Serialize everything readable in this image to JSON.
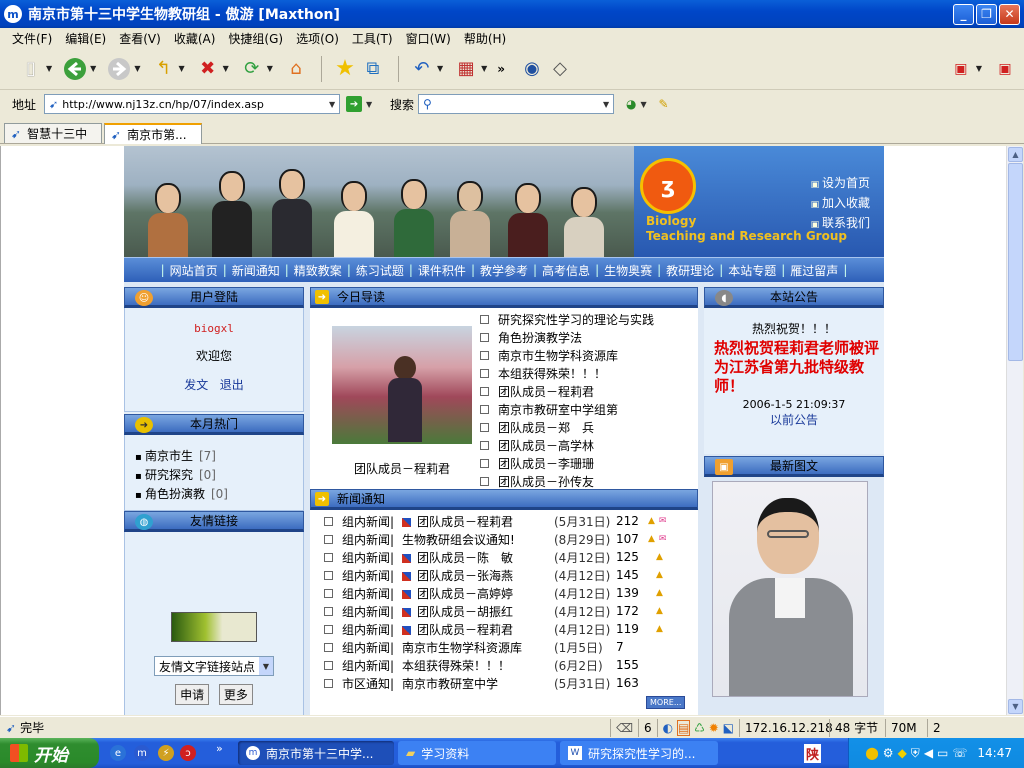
{
  "window": {
    "title": "南京市第十三中学生物教研组 - 傲游 [Maxthon]"
  },
  "menu": [
    "文件(F)",
    "编辑(E)",
    "查看(V)",
    "收藏(A)",
    "快捷组(G)",
    "选项(O)",
    "工具(T)",
    "窗口(W)",
    "帮助(H)"
  ],
  "toolbar": {
    "icons": [
      "new-page-icon",
      "back-icon",
      "forward-icon",
      "up-icon",
      "stop-icon",
      "refresh-icon",
      "home-icon",
      "favorites-star-icon",
      "switch-icon",
      "undo-icon",
      "calculator-icon",
      "compass-icon",
      "diamond-icon",
      "close-all-icon",
      "close-icon"
    ],
    "more": "»"
  },
  "address": {
    "label": "地址",
    "url": "http://www.nj13z.cn/hp/07/index.asp",
    "search_label": "搜索",
    "search_value": ""
  },
  "tabs": [
    "智慧十三中",
    "南京市第..."
  ],
  "site": {
    "logo_text1": "Biology",
    "logo_text2": "Teaching and Research Group",
    "quick_links": [
      "设为首页",
      "加入收藏",
      "联系我们"
    ],
    "nav": [
      "网站首页",
      "新闻通知",
      "精致教案",
      "练习试题",
      "课件积件",
      "教学参考",
      "高考信息",
      "生物奥赛",
      "教研理论",
      "本站专题",
      "雁过留声"
    ],
    "login": {
      "title": "用户登陆",
      "username": "biogxl",
      "welcome": "欢迎您",
      "post": "发文",
      "logout": "退出"
    },
    "hot": {
      "title": "本月热门",
      "items": [
        {
          "name": "南京市生",
          "count": "[7]"
        },
        {
          "name": "研究探究",
          "count": "[0]"
        },
        {
          "name": "角色扮演教",
          "count": "[0]"
        }
      ]
    },
    "links": {
      "title": "友情链接",
      "select": "友情文字链接站点",
      "apply": "申请",
      "more": "更多"
    },
    "guide": {
      "title": "今日导读",
      "caption": "团队成员－程莉君",
      "items": [
        "研究探究性学习的理论与实践",
        "角色扮演教学法",
        "南京市生物学科资源库",
        "本组获得殊荣！！！",
        "团队成员－程莉君",
        "南京市教研室中学组第",
        "团队成员－郑　兵",
        "团队成员－高学林",
        "团队成员－李珊珊",
        "团队成员－孙传友"
      ]
    },
    "news": {
      "title": "新闻通知",
      "more": "MORE...",
      "rows": [
        {
          "cat": "组内新闻|",
          "title": "团队成员－程莉君",
          "date": "(5月31日)",
          "count": "212",
          "icon": true,
          "up": true,
          "mail": true
        },
        {
          "cat": "组内新闻|",
          "title": "生物教研组会议通知!",
          "date": "(8月29日)",
          "count": "107",
          "icon": false,
          "up": true,
          "mail": true
        },
        {
          "cat": "组内新闻|",
          "title": "团队成员－陈　敏",
          "date": "(4月12日)",
          "count": "125",
          "icon": true,
          "up": true,
          "mail": false
        },
        {
          "cat": "组内新闻|",
          "title": "团队成员－张海燕",
          "date": "(4月12日)",
          "count": "145",
          "icon": true,
          "up": true,
          "mail": false
        },
        {
          "cat": "组内新闻|",
          "title": "团队成员－高婷婷",
          "date": "(4月12日)",
          "count": "139",
          "icon": true,
          "up": true,
          "mail": false
        },
        {
          "cat": "组内新闻|",
          "title": "团队成员－胡振红",
          "date": "(4月12日)",
          "count": "172",
          "icon": true,
          "up": true,
          "mail": false
        },
        {
          "cat": "组内新闻|",
          "title": "团队成员－程莉君",
          "date": "(4月12日)",
          "count": "119",
          "icon": true,
          "up": true,
          "mail": false
        },
        {
          "cat": "组内新闻|",
          "title": "南京市生物学科资源库",
          "date": "(1月5日)",
          "count": "7",
          "icon": false,
          "up": false,
          "mail": false
        },
        {
          "cat": "组内新闻|",
          "title": "本组获得殊荣！！！",
          "date": "(6月2日)",
          "count": "155",
          "icon": false,
          "up": false,
          "mail": false
        },
        {
          "cat": "市区通知|",
          "title": "南京市教研室中学",
          "date": "(5月31日)",
          "count": "163",
          "icon": false,
          "up": false,
          "mail": false
        }
      ]
    },
    "notice": {
      "title": "本站公告",
      "heading": "热烈祝贺！！！",
      "body": "热烈祝贺程莉君老师被评为江苏省第九批特级教师！",
      "date": "2006-1-5 21:09:37",
      "prev": "以前公告"
    },
    "photo_news": {
      "title": "最新图文"
    }
  },
  "status": {
    "text": "完毕",
    "count": "6",
    "ip": "172.16.12.218",
    "bytes": "48 字节",
    "mem": "70M",
    "num": "2"
  },
  "taskbar": {
    "start": "开始",
    "tasks": [
      "南京市第十三中学...",
      "学习资料",
      "研究探究性学习的..."
    ],
    "ime": "陕",
    "time": "14:47"
  },
  "colors": {
    "accent": "#2e5fb8",
    "notice_red": "#e00000",
    "title_blue": "#0046c8"
  }
}
